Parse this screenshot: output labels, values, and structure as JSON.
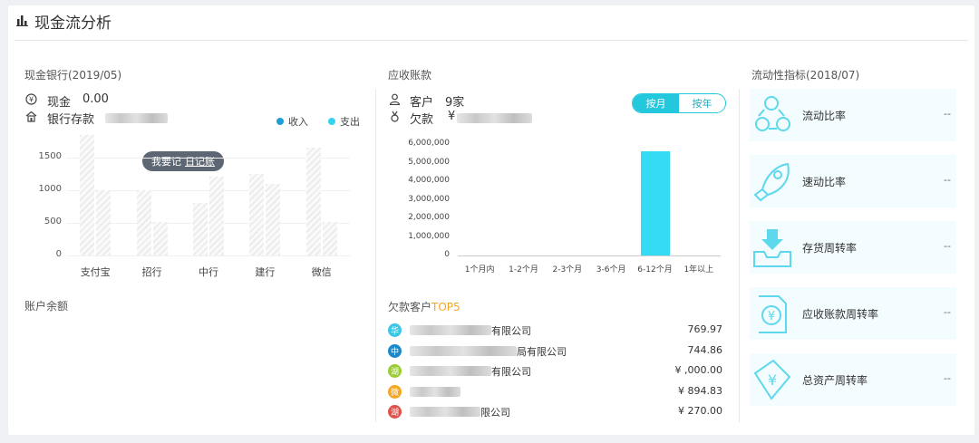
{
  "header": {
    "title": "现金流分析",
    "icon": "bar-chart-icon"
  },
  "bank": {
    "title": "现金银行(2019/05)",
    "cash_label": "现金",
    "cash_value": "0.00",
    "deposit_label": "银行存款",
    "legend": [
      {
        "label": "收入",
        "color": "#1f9ed8"
      },
      {
        "label": "支出",
        "color": "#34d4f0"
      }
    ],
    "tooltip": {
      "text": "我要记",
      "link": "日记账"
    }
  },
  "chart_data": [
    {
      "type": "bar",
      "categories": [
        "支付宝",
        "招行",
        "中行",
        "建行",
        "微信"
      ],
      "series": [
        {
          "name": "收入",
          "values": [
            1850,
            1000,
            800,
            1250,
            1650
          ]
        },
        {
          "name": "支出",
          "values": [
            1000,
            520,
            1200,
            1100,
            520
          ]
        }
      ],
      "yticks": [
        "0",
        "500",
        "1000",
        "1500"
      ],
      "ylim": [
        0,
        1900
      ]
    },
    {
      "type": "bar",
      "categories": [
        "1个月内",
        "1-2个月",
        "2-3个月",
        "3-6个月",
        "6-12个月",
        "1年以上"
      ],
      "values": [
        0,
        0,
        0,
        0,
        5600000,
        0
      ],
      "yticks": [
        "0",
        "1,000,000",
        "2,000,000",
        "3,000,000",
        "4,000,000",
        "5,000,000",
        "6,000,000"
      ],
      "ylim": [
        0,
        6000000
      ]
    }
  ],
  "receivable": {
    "title": "应收账款",
    "customer_label": "客户",
    "customer_count": "9家",
    "owed_label": "欠款",
    "owed_prefix": "¥",
    "toggle": {
      "monthly": "按月",
      "yearly": "按年",
      "active": "monthly"
    }
  },
  "balance": {
    "title": "账户余额"
  },
  "top5": {
    "title": "欠款客户",
    "title_accent": "TOP5",
    "accent_color": "#f5a623",
    "rows": [
      {
        "badge": "华",
        "color": "#3cc7e6",
        "name_suffix": "有限公司",
        "amount": "769.97"
      },
      {
        "badge": "中",
        "color": "#1b89c9",
        "name_suffix": "局有限公司",
        "amount": "744.86"
      },
      {
        "badge": "湖",
        "color": "#9acd32",
        "name_suffix": "有限公司",
        "amount": "¥ ,000.00"
      },
      {
        "badge": "微",
        "color": "#f5a623",
        "name_suffix": "",
        "amount": "¥ 894.83"
      },
      {
        "badge": "湖",
        "color": "#e0514b",
        "name_suffix": "限公司",
        "amount": "¥ 270.00"
      }
    ]
  },
  "liquidity": {
    "title": "流动性指标(2018/07)",
    "metrics": [
      {
        "label": "流动比率",
        "value": "--",
        "icon": "cycle-icon"
      },
      {
        "label": "速动比率",
        "value": "--",
        "icon": "rocket-icon"
      },
      {
        "label": "存货周转率",
        "value": "--",
        "icon": "inbox-icon"
      },
      {
        "label": "应收账款周转率",
        "value": "--",
        "icon": "yen-doc-icon"
      },
      {
        "label": "总资产周转率",
        "value": "--",
        "icon": "yen-tag-icon"
      }
    ]
  }
}
